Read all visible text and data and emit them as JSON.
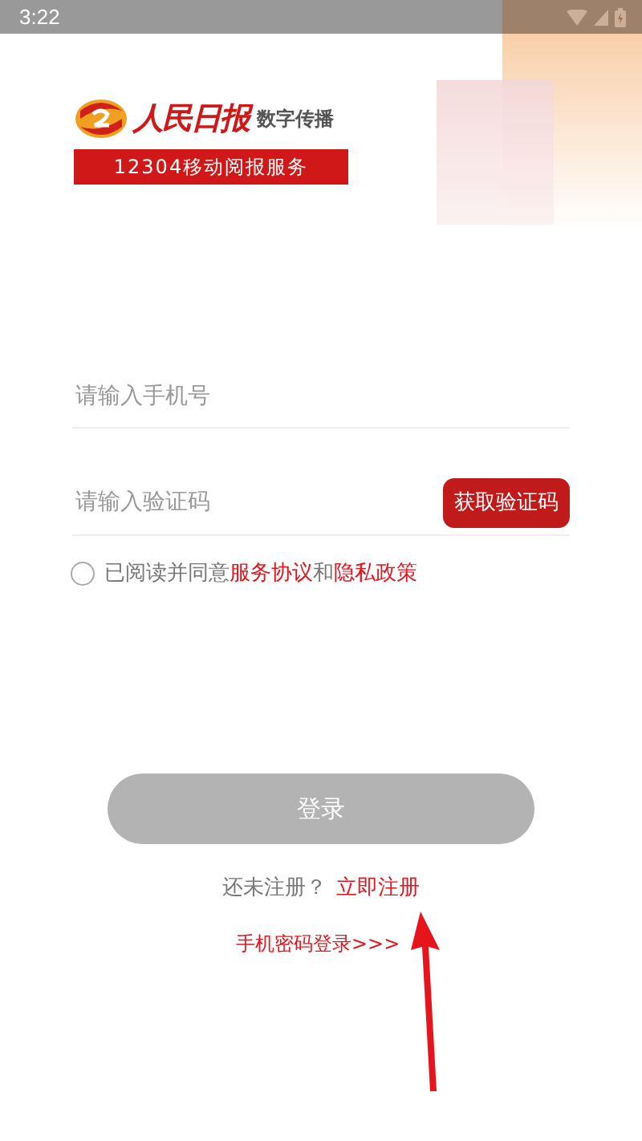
{
  "status_bar": {
    "time": "3:22"
  },
  "logo": {
    "brand": "人民日报",
    "subtitle": "数字传播",
    "banner": "12304移动阅报服务"
  },
  "phone_field": {
    "placeholder": "请输入手机号"
  },
  "code_field": {
    "placeholder": "请输入验证码",
    "button": "获取验证码"
  },
  "agreement": {
    "checked": false,
    "parts": [
      {
        "kind": "text",
        "text": "已阅读并同意"
      },
      {
        "kind": "link",
        "text": "服务协议"
      },
      {
        "kind": "text",
        "text": "和"
      },
      {
        "kind": "link",
        "text": "隐私政策"
      }
    ]
  },
  "login_button": {
    "label": "登录",
    "disabled": true
  },
  "register": {
    "prompt": "还未注册？",
    "link": "立即注册"
  },
  "password_login": {
    "label": "手机密码登录>>>"
  }
}
